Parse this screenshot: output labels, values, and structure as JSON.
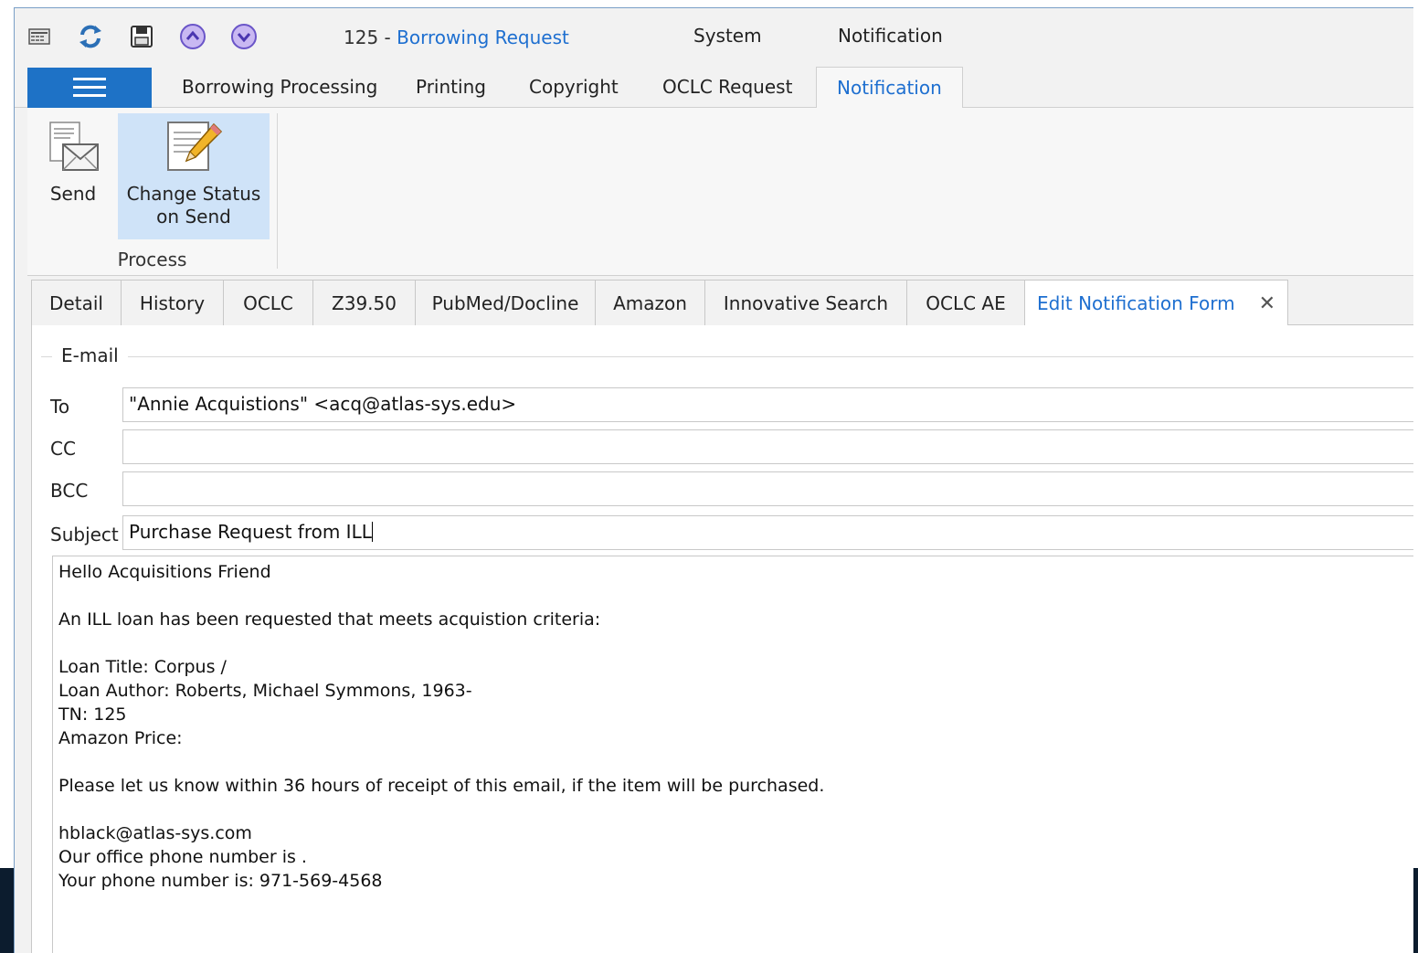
{
  "title": {
    "record_number": "125",
    "separator": " - ",
    "record_type": "Borrowing Request",
    "menus": [
      "System",
      "Notification"
    ]
  },
  "quick_access": {
    "icons": [
      "detail-icon",
      "refresh-icon",
      "save-icon",
      "previous-icon",
      "next-icon"
    ]
  },
  "ribbon": {
    "tabs": [
      "Borrowing Processing",
      "Printing",
      "Copyright",
      "OCLC Request",
      "Notification"
    ],
    "active_tab": "Notification",
    "buttons": {
      "send": "Send",
      "change_status_line1": "Change Status",
      "change_status_line2": "on Send"
    },
    "group_label": "Process"
  },
  "doc_tabs": {
    "items": [
      "Detail",
      "History",
      "OCLC",
      "Z39.50",
      "PubMed/Docline",
      "Amazon",
      "Innovative Search",
      "OCLC AE",
      "Edit Notification Form"
    ],
    "active": "Edit Notification Form"
  },
  "email": {
    "legend": "E-mail",
    "to_label": "To",
    "to_value": "\"Annie Acquistions\" <acq@atlas-sys.edu>",
    "cc_label": "CC",
    "cc_value": "",
    "bcc_label": "BCC",
    "bcc_value": "",
    "subject_label": "Subject",
    "subject_value": "Purchase Request from ILL",
    "body_lines": [
      "Hello Acquisitions Friend",
      "",
      "An ILL loan has been requested that meets acquistion criteria:",
      "",
      "Loan Title: Corpus /",
      "Loan Author: Roberts, Michael Symmons, 1963-",
      "TN: 125",
      "Amazon Price:",
      "",
      "Please let us know within 36 hours of receipt of this email, if the item will be purchased.",
      "",
      "hblack@atlas-sys.com",
      "Our office phone number is .",
      "Your phone number is: 971-569-4568"
    ]
  },
  "colors": {
    "accent": "#1e72c6",
    "active_text": "#1e6fd0",
    "selected_button": "#cfe3f8"
  }
}
